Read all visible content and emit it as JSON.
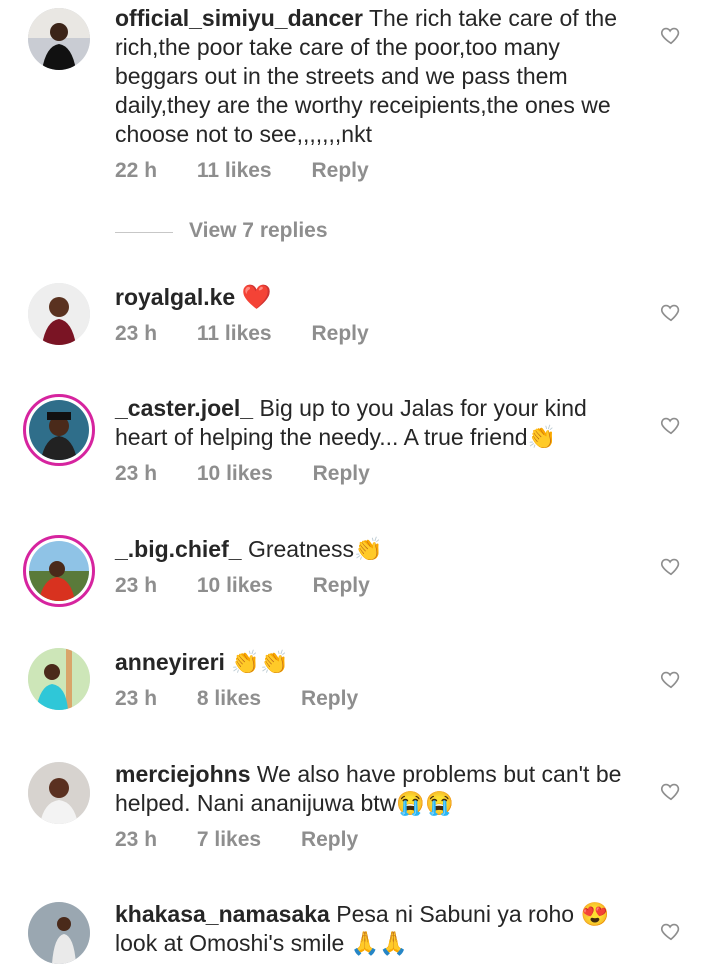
{
  "comments": [
    {
      "username": "official_simiyu_dancer",
      "text": "The rich take care of the rich,the poor take care of the poor,too many beggars out in the streets and we pass them daily,they are the worthy receipients,the ones we choose not to see,,,,,,,nkt",
      "time": "22 h",
      "likes": "11 likes",
      "reply": "Reply"
    },
    {
      "username": "royalgal.ke",
      "text": "❤️",
      "time": "23 h",
      "likes": "11 likes",
      "reply": "Reply"
    },
    {
      "username": "_caster.joel_",
      "text": "Big up to you Jalas for your kind heart of helping the needy... A true friend👏",
      "time": "23 h",
      "likes": "10 likes",
      "reply": "Reply"
    },
    {
      "username": "_.big.chief_",
      "text": "Greatness👏",
      "time": "23 h",
      "likes": "10 likes",
      "reply": "Reply"
    },
    {
      "username": "anneyireri",
      "text": "👏👏",
      "time": "23 h",
      "likes": "8 likes",
      "reply": "Reply"
    },
    {
      "username": "merciejohns",
      "text": "We also have problems but can't be helped. Nani ananijuwa btw😭😭",
      "time": "23 h",
      "likes": "7 likes",
      "reply": "Reply"
    },
    {
      "username": "khakasa_namasaka",
      "text": "Pesa ni Sabuni ya roho 😍 look at Omoshi's smile 🙏🙏",
      "time": "",
      "likes": "",
      "reply": ""
    }
  ],
  "view_replies": "View 7 replies",
  "icons": {
    "heart": "heart-outline-icon"
  }
}
